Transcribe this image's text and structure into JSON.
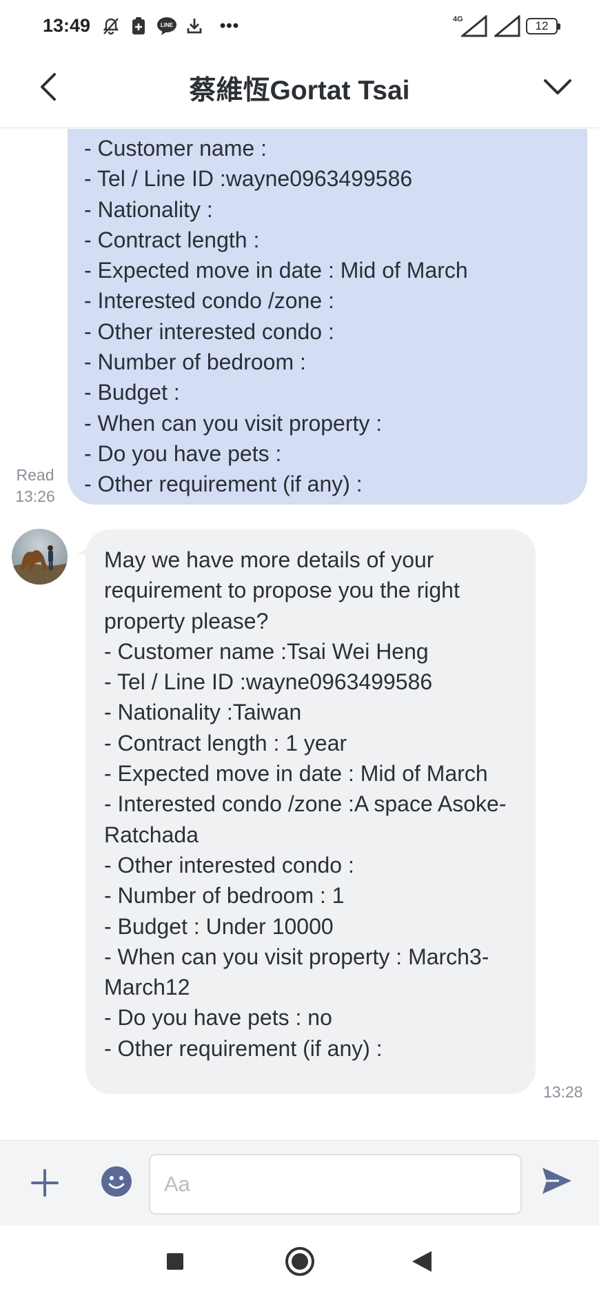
{
  "status_bar": {
    "time": "13:49",
    "network": "4G",
    "battery": "12",
    "more": "•••",
    "icons": [
      "mute-icon",
      "app-notification-icon",
      "line-icon",
      "download-icon",
      "signal-icon",
      "battery-icon"
    ]
  },
  "header": {
    "title": "蔡維恆Gortat Tsai",
    "icons": [
      "back-arrow-icon",
      "chevron-down-icon"
    ]
  },
  "sent_message": {
    "lines": [
      "- Customer name :",
      "- Tel / Line ID :wayne0963499586",
      "- Nationality :",
      "- Contract length :",
      "- Expected move in date : Mid of March",
      "- Interested condo /zone :",
      "- Other interested condo :",
      "- Number of bedroom  :",
      "- Budget :",
      "- When can you visit property :",
      "- Do you have pets :",
      "- Other requirement (if any) :"
    ],
    "read_label": "Read",
    "time": "13:26"
  },
  "received_message": {
    "lines": [
      "May we have more details of your requirement to propose you the right property please?",
      "- Customer name :Tsai Wei Heng",
      "- Tel / Line ID :wayne0963499586",
      "- Nationality :Taiwan",
      "- Contract length :  1 year",
      "- Expected move in date : Mid of March",
      "- Interested condo /zone :A space Asoke-Ratchada",
      "- Other interested condo :",
      "- Number of bedroom  : 1",
      "- Budget : Under 10000",
      "- When can you visit property : March3-March12",
      "- Do you have pets : no",
      "- Other requirement (if any) :"
    ],
    "time": "13:28"
  },
  "input_bar": {
    "placeholder": "Aa",
    "value": "",
    "icons": [
      "plus-icon",
      "emoji-icon",
      "send-icon"
    ]
  },
  "nav_bar": {
    "icons": [
      "recents-icon",
      "home-icon",
      "back-icon"
    ]
  },
  "colors": {
    "sent_bubble": "#d3ddf4",
    "received_bubble": "#f0f1f3",
    "icon_accent": "#5b6a94",
    "meta_text": "#8a9099"
  }
}
